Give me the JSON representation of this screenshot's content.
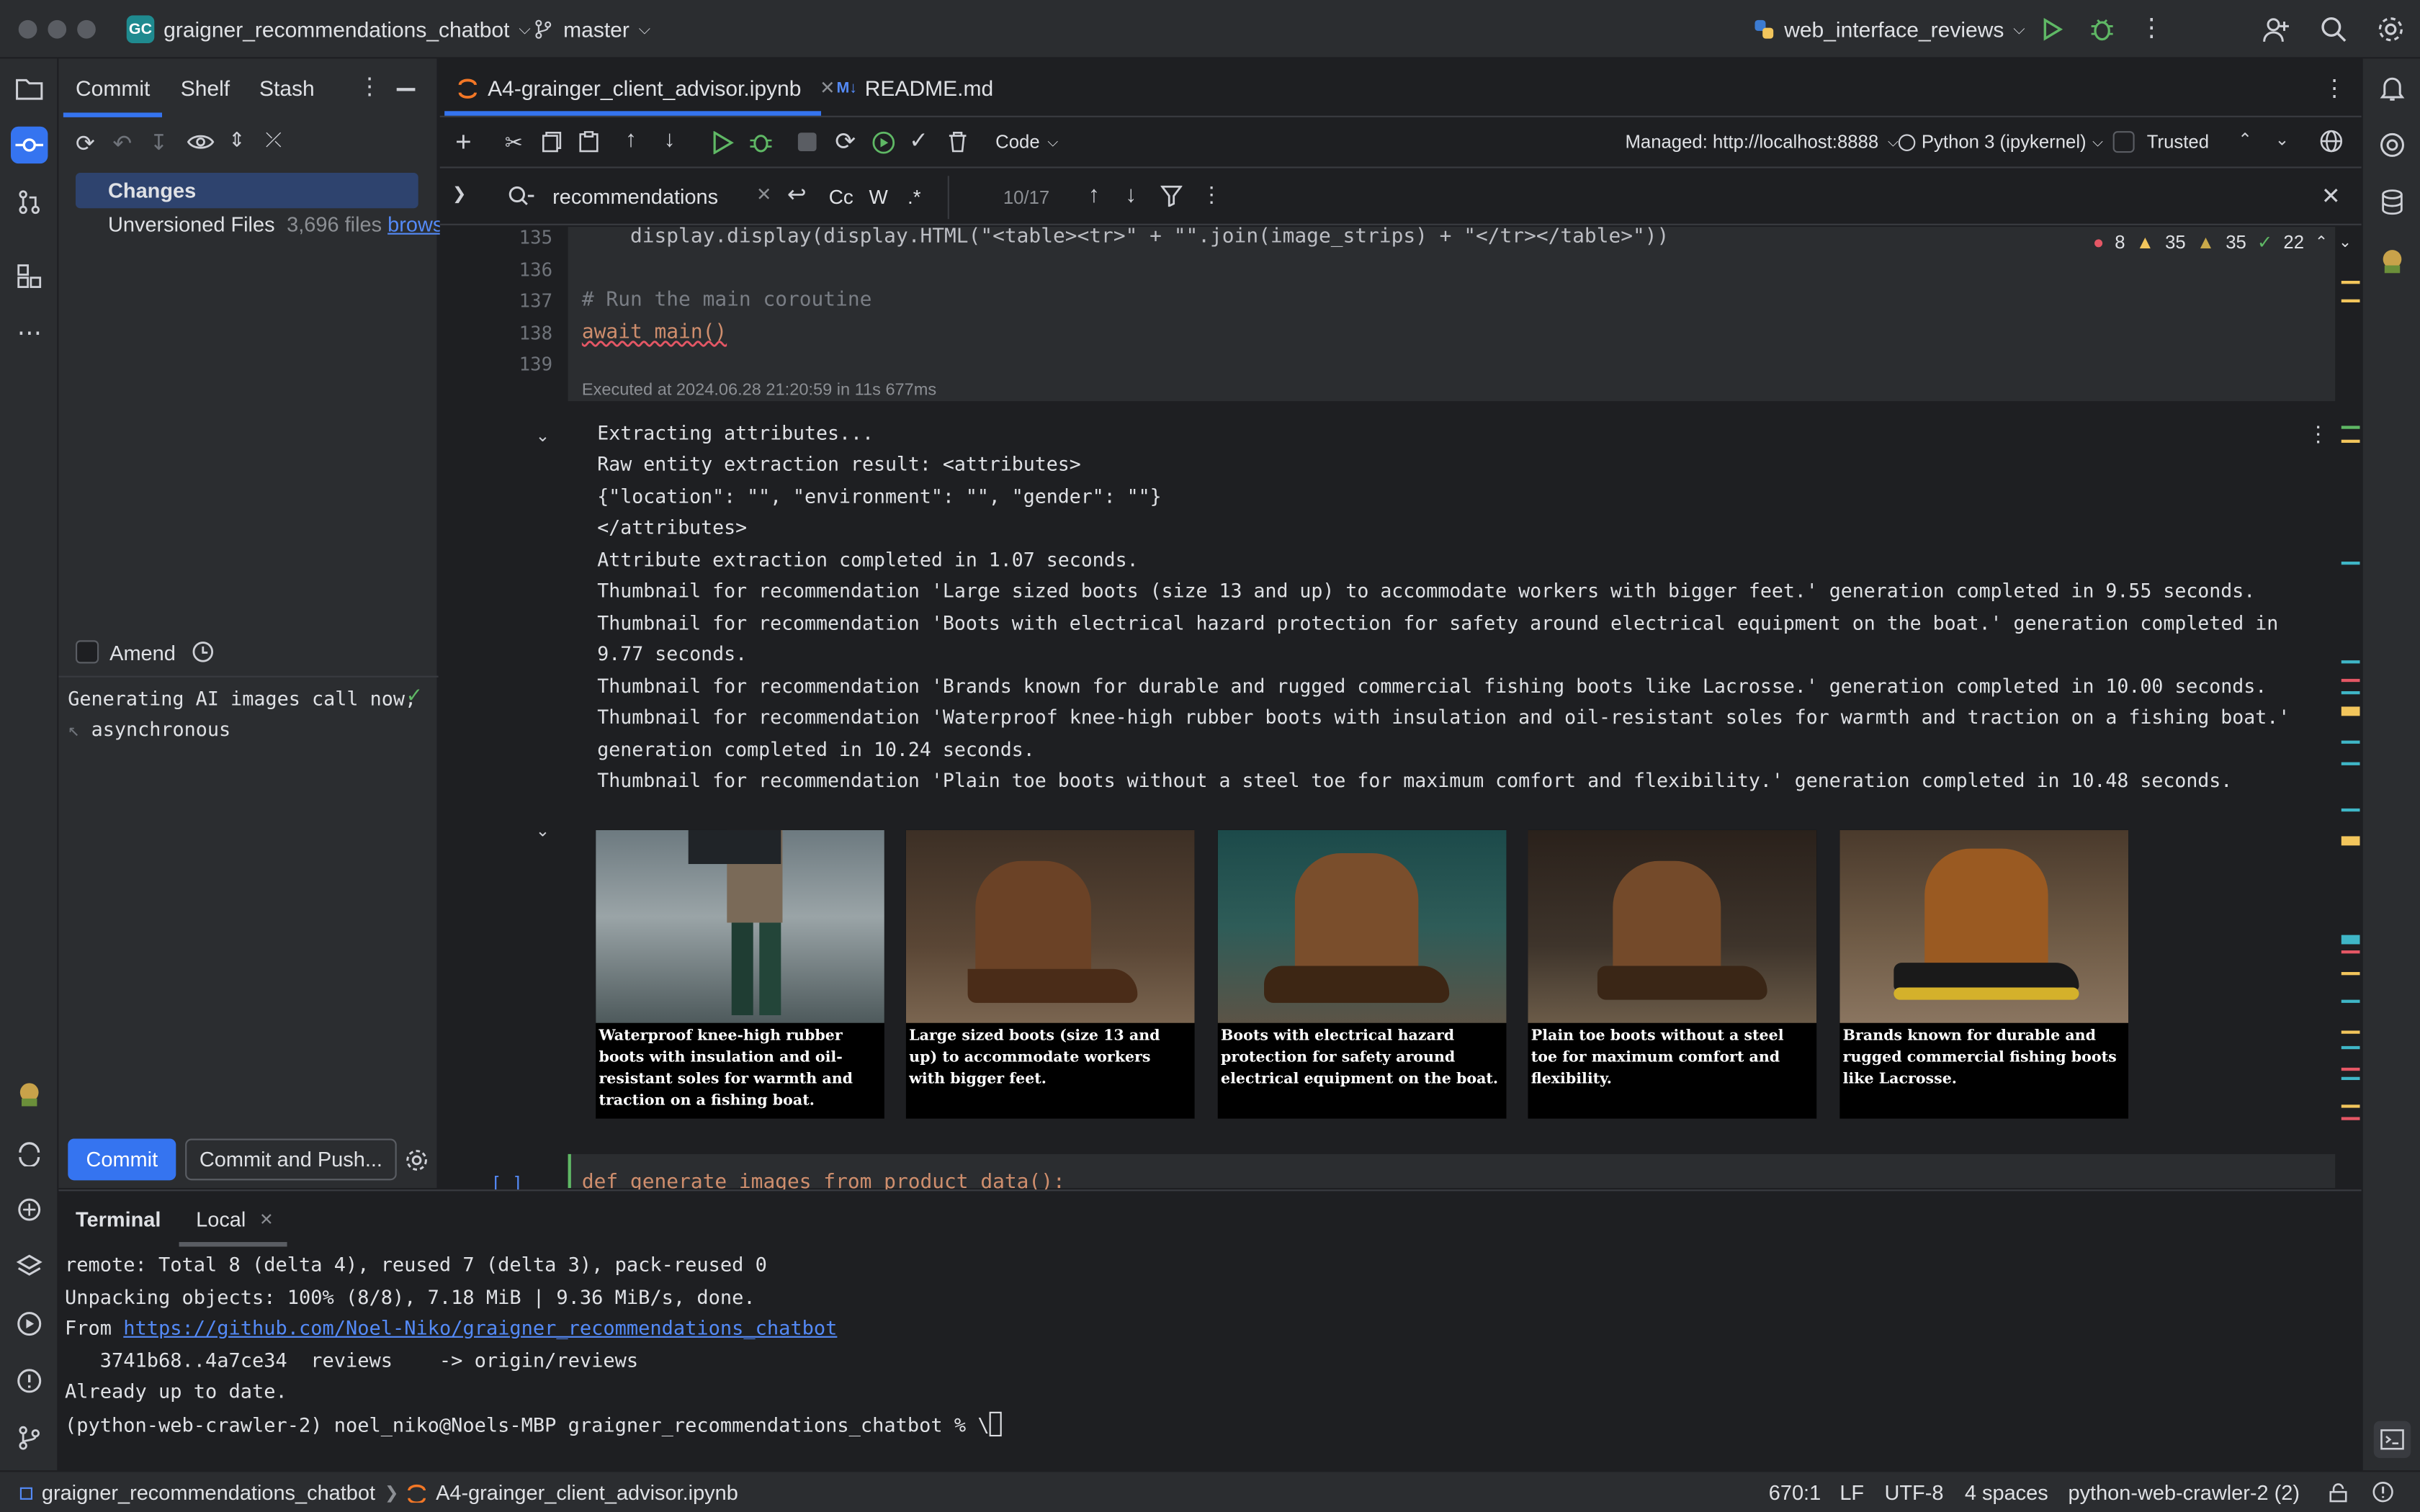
{
  "titlebar": {
    "project_badge": "GC",
    "project_name": "graigner_recommendations_chatbot",
    "branch": "master",
    "run_config": "web_interface_reviews"
  },
  "commit_panel": {
    "tabs": [
      "Commit",
      "Shelf",
      "Stash"
    ],
    "changes_label": "Changes",
    "unversioned_label": "Unversioned Files",
    "unversioned_count": "3,696 files",
    "unversioned_link": "browse",
    "amend_label": "Amend",
    "commit_message": [
      "Generating AI images call now,",
      "asynchronous"
    ],
    "commit_button": "Commit",
    "commit_push_button": "Commit and Push..."
  },
  "editor": {
    "tabs": [
      {
        "label": "A4-grainger_client_advisor.ipynb",
        "active": true
      },
      {
        "label": "README.md",
        "active": false
      }
    ],
    "toolbar": {
      "cell_type": "Code",
      "server": "Managed: http://localhost:8888",
      "kernel": "Python 3 (ipykernel)",
      "trusted": "Trusted"
    },
    "find": {
      "query": "recommendations",
      "count": "10/17",
      "opt_case": "Cc",
      "opt_word": "W",
      "opt_regex": ".*"
    },
    "inspections": {
      "errors": "8",
      "warnings": "35",
      "weak_warnings": "35",
      "ok": "22"
    },
    "code_lines": [
      {
        "num": "135",
        "text": "    display.display(display.HTML(\"<table><tr>\" + \"\".join(image_strips) + \"</tr></table>\"))"
      },
      {
        "num": "136",
        "text": ""
      },
      {
        "num": "137",
        "text": "# Run the main coroutine"
      },
      {
        "num": "138",
        "text": "await main()"
      },
      {
        "num": "139",
        "text": ""
      }
    ],
    "executed": "Executed at 2024.06.28 21:20:59 in 11s 677ms",
    "output_lines": [
      "Extracting attributes...",
      "Raw entity extraction result: <attributes>",
      "{\"location\": \"\", \"environment\": \"\", \"gender\": \"\"}",
      "</attributes>",
      "Attribute extraction completed in 1.07 seconds.",
      "Thumbnail for recommendation 'Large sized boots (size 13 and up) to accommodate workers with bigger feet.' generation completed in 9.55 seconds.",
      "Thumbnail for recommendation 'Boots with electrical hazard protection for safety around electrical equipment on the boat.' generation completed in",
      "9.77 seconds.",
      "Thumbnail for recommendation 'Brands known for durable and rugged commercial fishing boots like Lacrosse.' generation completed in 10.00 seconds.",
      "Thumbnail for recommendation 'Waterproof knee-high rubber boots with insulation and oil-resistant soles for warmth and traction on a fishing boat.'",
      "generation completed in 10.24 seconds.",
      "Thumbnail for recommendation 'Plain toe boots without a steel toe for maximum comfort and flexibility.' generation completed in 10.48 seconds."
    ],
    "thumbnails": [
      "Waterproof knee-high rubber boots with insulation and oil-resistant soles for warmth and traction on a fishing boat.",
      "Large sized boots (size 13 and up) to accommodate workers with bigger feet.",
      "Boots with electrical hazard protection for safety around electrical equipment on the boat.",
      "Plain toe boots without a steel toe for maximum comfort and flexibility.",
      "Brands known for durable and rugged commercial fishing boots like Lacrosse."
    ],
    "next_cell_prompt": "[ ]",
    "next_cell_code": "def generate_images_from_product_data():"
  },
  "terminal": {
    "title": "Terminal",
    "tab": "Local",
    "lines": [
      "remote: Total 8 (delta 4), reused 7 (delta 3), pack-reused 0",
      "Unpacking objects: 100% (8/8), 7.18 MiB | 9.36 MiB/s, done."
    ],
    "from_label": "From ",
    "from_url": "https://github.com/Noel-Niko/graigner_recommendations_chatbot",
    "lines2": [
      "   3741b68..4a7ce34  reviews    -> origin/reviews",
      "Already up to date.",
      "(python-web-crawler-2) noel_niko@Noels-MBP graigner_recommendations_chatbot % \\"
    ]
  },
  "statusbar": {
    "project": "graigner_recommendations_chatbot",
    "file": "A4-grainger_client_advisor.ipynb",
    "position": "670:1",
    "line_sep": "LF",
    "encoding": "UTF-8",
    "indent": "4 spaces",
    "interpreter": "python-web-crawler-2 (2)"
  },
  "colors": {
    "accent": "#3574f0",
    "error": "#e55765",
    "warning": "#f2c55c",
    "ok": "#5fb865"
  }
}
